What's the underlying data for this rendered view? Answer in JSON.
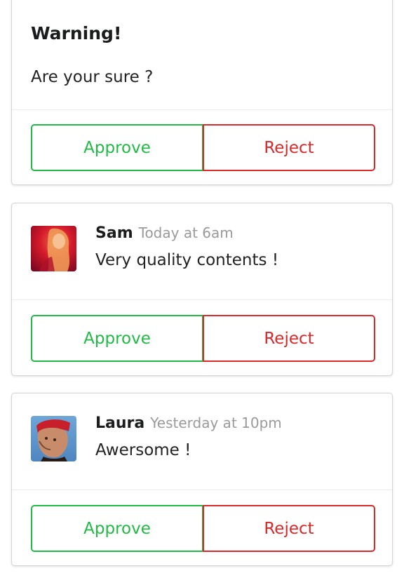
{
  "colors": {
    "approve": "#21ba45",
    "reject": "#db2828",
    "meta_text": "#9a9a9a"
  },
  "warning_card": {
    "header": "Warning!",
    "description": "Are your sure ?",
    "approve_label": "Approve",
    "reject_label": "Reject"
  },
  "comments": [
    {
      "avatar": "user-avatar-sam",
      "name": "Sam",
      "time": "Today at 6am",
      "text": "Very quality contents !",
      "approve_label": "Approve",
      "reject_label": "Reject"
    },
    {
      "avatar": "user-avatar-laura",
      "name": "Laura",
      "time": "Yesterday at 10pm",
      "text": "Awersome !",
      "approve_label": "Approve",
      "reject_label": "Reject"
    }
  ]
}
